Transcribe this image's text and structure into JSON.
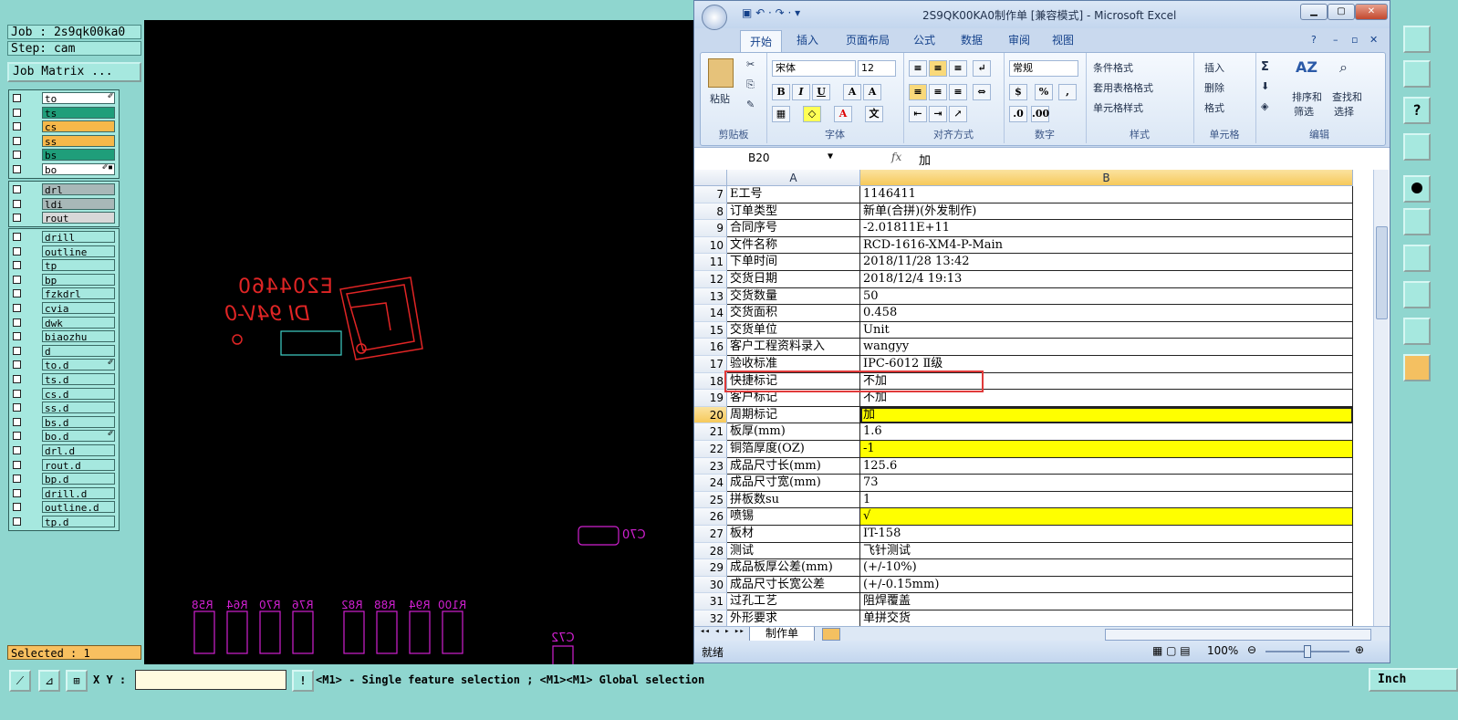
{
  "genesis": {
    "job_label": "Job : 2s9qk00ka0",
    "step_label": "Step: cam",
    "job_matrix_label": "Job Matrix ...",
    "layers": [
      {
        "name": "to",
        "color": "#ffffff",
        "mark": "✐"
      },
      {
        "name": "ts",
        "color": "#1f9e7a",
        "mark": ""
      },
      {
        "name": "cs",
        "color": "#f6b84a",
        "mark": ""
      },
      {
        "name": "ss",
        "color": "#f6b84a",
        "mark": ""
      },
      {
        "name": "bs",
        "color": "#1f9e7a",
        "mark": ""
      },
      {
        "name": "bo",
        "color": "#ffffff",
        "mark": "✐▪"
      },
      {
        "name": "drl",
        "color": "#a8b8b8",
        "mark": ""
      },
      {
        "name": "ldi",
        "color": "#a8b8b8",
        "mark": ""
      },
      {
        "name": "rout",
        "color": "#d8d8d8",
        "mark": ""
      },
      {
        "name": "drill",
        "color": "#a6e8df",
        "mark": ""
      },
      {
        "name": "outline",
        "color": "#a6e8df",
        "mark": ""
      },
      {
        "name": "tp",
        "color": "#a6e8df",
        "mark": ""
      },
      {
        "name": "bp",
        "color": "#a6e8df",
        "mark": ""
      },
      {
        "name": "fzkdrl",
        "color": "#a6e8df",
        "mark": ""
      },
      {
        "name": "cvia",
        "color": "#a6e8df",
        "mark": ""
      },
      {
        "name": "dwk",
        "color": "#a6e8df",
        "mark": ""
      },
      {
        "name": "biaozhu",
        "color": "#a6e8df",
        "mark": ""
      },
      {
        "name": "d",
        "color": "#a6e8df",
        "mark": ""
      },
      {
        "name": "to.d",
        "color": "#a6e8df",
        "mark": "✐"
      },
      {
        "name": "ts.d",
        "color": "#a6e8df",
        "mark": ""
      },
      {
        "name": "cs.d",
        "color": "#a6e8df",
        "mark": ""
      },
      {
        "name": "ss.d",
        "color": "#a6e8df",
        "mark": ""
      },
      {
        "name": "bs.d",
        "color": "#a6e8df",
        "mark": ""
      },
      {
        "name": "bo.d",
        "color": "#a6e8df",
        "mark": "✐"
      },
      {
        "name": "drl.d",
        "color": "#a6e8df",
        "mark": ""
      },
      {
        "name": "rout.d",
        "color": "#a6e8df",
        "mark": ""
      },
      {
        "name": "bp.d",
        "color": "#a6e8df",
        "mark": ""
      },
      {
        "name": "drill.d",
        "color": "#a6e8df",
        "mark": ""
      },
      {
        "name": "outline.d",
        "color": "#a6e8df",
        "mark": ""
      },
      {
        "name": "tp.d",
        "color": "#a6e8df",
        "mark": ""
      }
    ],
    "selected_label": "Selected : 1",
    "xy_label": "X Y :",
    "xy_value": "",
    "message": "<M1> - Single feature selection ; <M1><M1> Global selection",
    "unit_label": "Inch",
    "canvas_texts": {
      "logo_code": "E204460",
      "logo_rating": "DI 94V-0",
      "c70": "C70",
      "c72": "C72",
      "refs": [
        "R58",
        "R64",
        "R70",
        "R76",
        "R82",
        "R88",
        "R94",
        "R100"
      ]
    }
  },
  "excel": {
    "title": "2S9QK00KA0制作单 [兼容模式] - Microsoft Excel",
    "tabs": [
      "开始",
      "插入",
      "页面布局",
      "公式",
      "数据",
      "审阅",
      "视图"
    ],
    "ribbon": {
      "clipboard": {
        "label": "剪贴板",
        "paste": "粘贴"
      },
      "font": {
        "label": "字体",
        "name": "宋体",
        "size": "12"
      },
      "align": {
        "label": "对齐方式"
      },
      "number": {
        "label": "数字",
        "format": "常规"
      },
      "styles": {
        "label": "样式",
        "cond": "条件格式",
        "table": "套用表格格式",
        "cell": "单元格样式"
      },
      "cells": {
        "label": "单元格",
        "insert": "插入",
        "delete": "删除",
        "format": "格式"
      },
      "edit": {
        "label": "编辑",
        "sort": "排序和",
        "filter": "筛选",
        "find": "查找和",
        "select": "选择"
      }
    },
    "namebox": "B20",
    "formula": "加",
    "col_a": "A",
    "col_b": "B",
    "rows": [
      {
        "n": "7",
        "a": "E工号",
        "b": "1146411",
        "hl": false
      },
      {
        "n": "8",
        "a": "订单类型",
        "b": "新单(合拼)(外发制作)",
        "hl": false
      },
      {
        "n": "9",
        "a": "合同序号",
        "b": "-2.01811E+11",
        "hl": false
      },
      {
        "n": "10",
        "a": "文件名称",
        "b": "RCD-1616-XM4-P-Main",
        "hl": false
      },
      {
        "n": "11",
        "a": "下单时间",
        "b": "2018/11/28 13:42",
        "hl": false
      },
      {
        "n": "12",
        "a": "交货日期",
        "b": "2018/12/4 19:13",
        "hl": false
      },
      {
        "n": "13",
        "a": "交货数量",
        "b": "50",
        "hl": false
      },
      {
        "n": "14",
        "a": "交货面积",
        "b": "0.458",
        "hl": false
      },
      {
        "n": "15",
        "a": "交货单位",
        "b": "Unit",
        "hl": false
      },
      {
        "n": "16",
        "a": "客户工程资料录入",
        "b": "wangyy",
        "hl": false
      },
      {
        "n": "17",
        "a": "验收标准",
        "b": "IPC-6012 Ⅱ级",
        "hl": false
      },
      {
        "n": "18",
        "a": "快捷标记",
        "b": "不加",
        "hl": false
      },
      {
        "n": "19",
        "a": "客户标记",
        "b": "不加",
        "hl": false
      },
      {
        "n": "20",
        "a": "周期标记",
        "b": "加",
        "hl": true
      },
      {
        "n": "21",
        "a": "板厚(mm)",
        "b": "1.6",
        "hl": false
      },
      {
        "n": "22",
        "a": "铜箔厚度(OZ)",
        "b": "-1",
        "hl": true
      },
      {
        "n": "23",
        "a": "成品尺寸长(mm)",
        "b": "125.6",
        "hl": false
      },
      {
        "n": "24",
        "a": "成品尺寸宽(mm)",
        "b": "73",
        "hl": false
      },
      {
        "n": "25",
        "a": "拼板数su",
        "b": "1",
        "hl": false
      },
      {
        "n": "26",
        "a": "喷锡",
        "b": "√",
        "hl": true
      },
      {
        "n": "27",
        "a": "板材",
        "b": "IT-158",
        "hl": false
      },
      {
        "n": "28",
        "a": "测试",
        "b": "飞针测试",
        "hl": false
      },
      {
        "n": "29",
        "a": "成品板厚公差(mm)",
        "b": "(+/-10%)",
        "hl": false
      },
      {
        "n": "30",
        "a": "成品尺寸长宽公差",
        "b": "(+/-0.15mm)",
        "hl": false
      },
      {
        "n": "31",
        "a": "过孔工艺",
        "b": "阻焊覆盖",
        "hl": false
      },
      {
        "n": "32",
        "a": "外形要求",
        "b": "单拼交货",
        "hl": false
      }
    ],
    "sheet_tab": "制作单",
    "status": "就绪",
    "zoom": "100%"
  }
}
